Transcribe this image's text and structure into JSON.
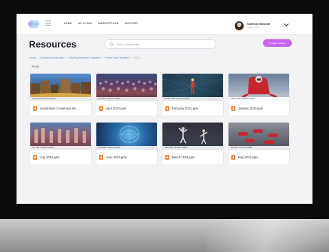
{
  "nav": {
    "items": [
      "HOME",
      "MY CLINIC",
      "MARKETPLACE",
      "SUPPORT"
    ]
  },
  "user": {
    "name": "Cameron Marshall",
    "subtitle": "Sample Clinic"
  },
  "page": {
    "title": "Resources",
    "search_placeholder": "Search Resources",
    "create_button": "Create Videos",
    "breadcrumb": [
      "Home",
      "Continuing Education",
      "Monthly Research Updates",
      "Power Point Reviews",
      "2023"
    ],
    "section_label": "FILES"
  },
  "files": [
    {
      "name": "Amsterdam Consensus Re...",
      "caption": "Amsterdam Consensus Review",
      "icon": "powerpoint-icon"
    },
    {
      "name": "April 2023.pptx",
      "caption": "April 2023 · Research Update",
      "icon": "powerpoint-icon"
    },
    {
      "name": "February 2023.pptx",
      "caption": "February 2023 · Research Update",
      "icon": "powerpoint-icon"
    },
    {
      "name": "January 2023.pptx",
      "caption": "January 2023 · Research Update",
      "icon": "powerpoint-icon"
    },
    {
      "name": "July 2023.pptx",
      "caption": "July 2023 · Research Update",
      "icon": "powerpoint-icon"
    },
    {
      "name": "June 2023.pptx",
      "caption": "June 2023 · Research Update",
      "icon": "powerpoint-icon"
    },
    {
      "name": "March 2023.pptx",
      "caption": "March 2023 · Research Update",
      "icon": "powerpoint-icon"
    },
    {
      "name": "May 2023.pptx",
      "caption": "May 2023 · Research Update",
      "icon": "powerpoint-icon"
    }
  ],
  "colors": {
    "accent": "#c864ee",
    "link": "#4a8fd6",
    "file_icon": "#f08a3a"
  }
}
